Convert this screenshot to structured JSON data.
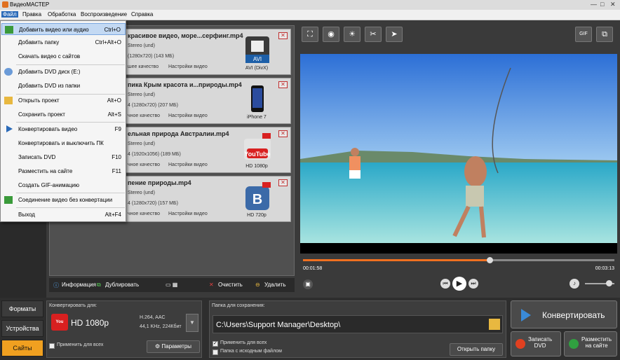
{
  "window": {
    "title": "ВидеоМАСТЕР",
    "controls": [
      "—",
      "□",
      "✕"
    ]
  },
  "menu": [
    "Файл",
    "Правка",
    "Обработка",
    "Воспроизведение",
    "Справка"
  ],
  "file_menu": [
    {
      "label": "Добавить видео или аудио",
      "shortcut": "Ctrl+O",
      "icon": "add-video-icon"
    },
    {
      "label": "Добавить папку",
      "shortcut": "Ctrl+Alt+O",
      "icon": ""
    },
    {
      "label": "Скачать видео с сайтов",
      "shortcut": "",
      "icon": ""
    },
    {
      "label": "Добавить DVD диск (E:)",
      "shortcut": "",
      "icon": "dvd-icon"
    },
    {
      "label": "Добавить DVD из папки",
      "shortcut": "",
      "icon": ""
    },
    {
      "label": "Открыть проект",
      "shortcut": "Alt+O",
      "icon": "folder-icon"
    },
    {
      "label": "Сохранить проект",
      "shortcut": "Alt+S",
      "icon": ""
    },
    {
      "label": "Конвертировать видео",
      "shortcut": "F9",
      "icon": "play-arrow-icon"
    },
    {
      "label": "Конвертировать и выключить ПК",
      "shortcut": "F10",
      "icon": ""
    },
    {
      "label": "Записать DVD",
      "shortcut": "F10",
      "icon": ""
    },
    {
      "label": "Разместить на сайте",
      "shortcut": "F11",
      "icon": ""
    },
    {
      "label": "Создать GIF-анимацию",
      "shortcut": "",
      "icon": ""
    },
    {
      "label": "Соединение видео без конвертации",
      "shortcut": "",
      "icon": "join-icon"
    },
    {
      "label": "Выход",
      "shortcut": "Alt+F4",
      "icon": ""
    }
  ],
  "files": [
    {
      "name": "красивое видео, море...серфинг.mp4",
      "audio": "Stereo (und)",
      "info": "(1280x720) (143 МБ)",
      "quality": "шее качество",
      "settings": "Настройки видео",
      "format": "AVI (DivX)",
      "fmt_text": "AVI"
    },
    {
      "name": "пика Крым красота и...природы.mp4",
      "audio": "Stereo (und)",
      "info": "4 (1280x720) (207 МБ)",
      "quality": "чное качество",
      "settings": "Настройки видео",
      "format": "iPhone 7",
      "fmt_text": ""
    },
    {
      "name": "ельная природа Австралии.mp4",
      "audio": "Stereo (und)",
      "info": "4 (1920x1056) (189 МБ)",
      "quality": "чное качество",
      "settings": "Настройки видео",
      "format": "HD 1080p",
      "fmt_text": "YouTube"
    },
    {
      "name": "пение природы.mp4",
      "audio": "Stereo (und)",
      "info": "4 (1280x720) (157 МБ)",
      "quality": "чное качество",
      "settings": "Настройки видео",
      "format": "HD 720p",
      "fmt_text": "B"
    }
  ],
  "list_toolbar": {
    "info": "Информация",
    "duplicate": "Дублировать",
    "clear": "Очистить",
    "delete": "Удалить"
  },
  "preview": {
    "gif": "GIF",
    "time_current": "00:01:58",
    "time_total": "00:03:13",
    "progress": 0.6
  },
  "left_tabs": [
    "Форматы",
    "Устройства",
    "Сайты"
  ],
  "convert_for": {
    "label": "Конвертировать для:",
    "format": "HD 1080p",
    "codec": "H.264, AAC",
    "audio": "44,1 KHz, 224Кбит",
    "apply_all": "Применить для всех",
    "params": "Параметры"
  },
  "save_folder": {
    "label": "Папка для сохранения:",
    "path": "C:\\Users\\Support Manager\\Desktop\\",
    "apply_all": "Применить для всех",
    "source_folder": "Папка с исходным файлом",
    "open_folder": "Открыть папку"
  },
  "actions": {
    "convert": "Конвертировать",
    "dvd": "Записать\nDVD",
    "publish": "Разместить\nна сайте"
  }
}
